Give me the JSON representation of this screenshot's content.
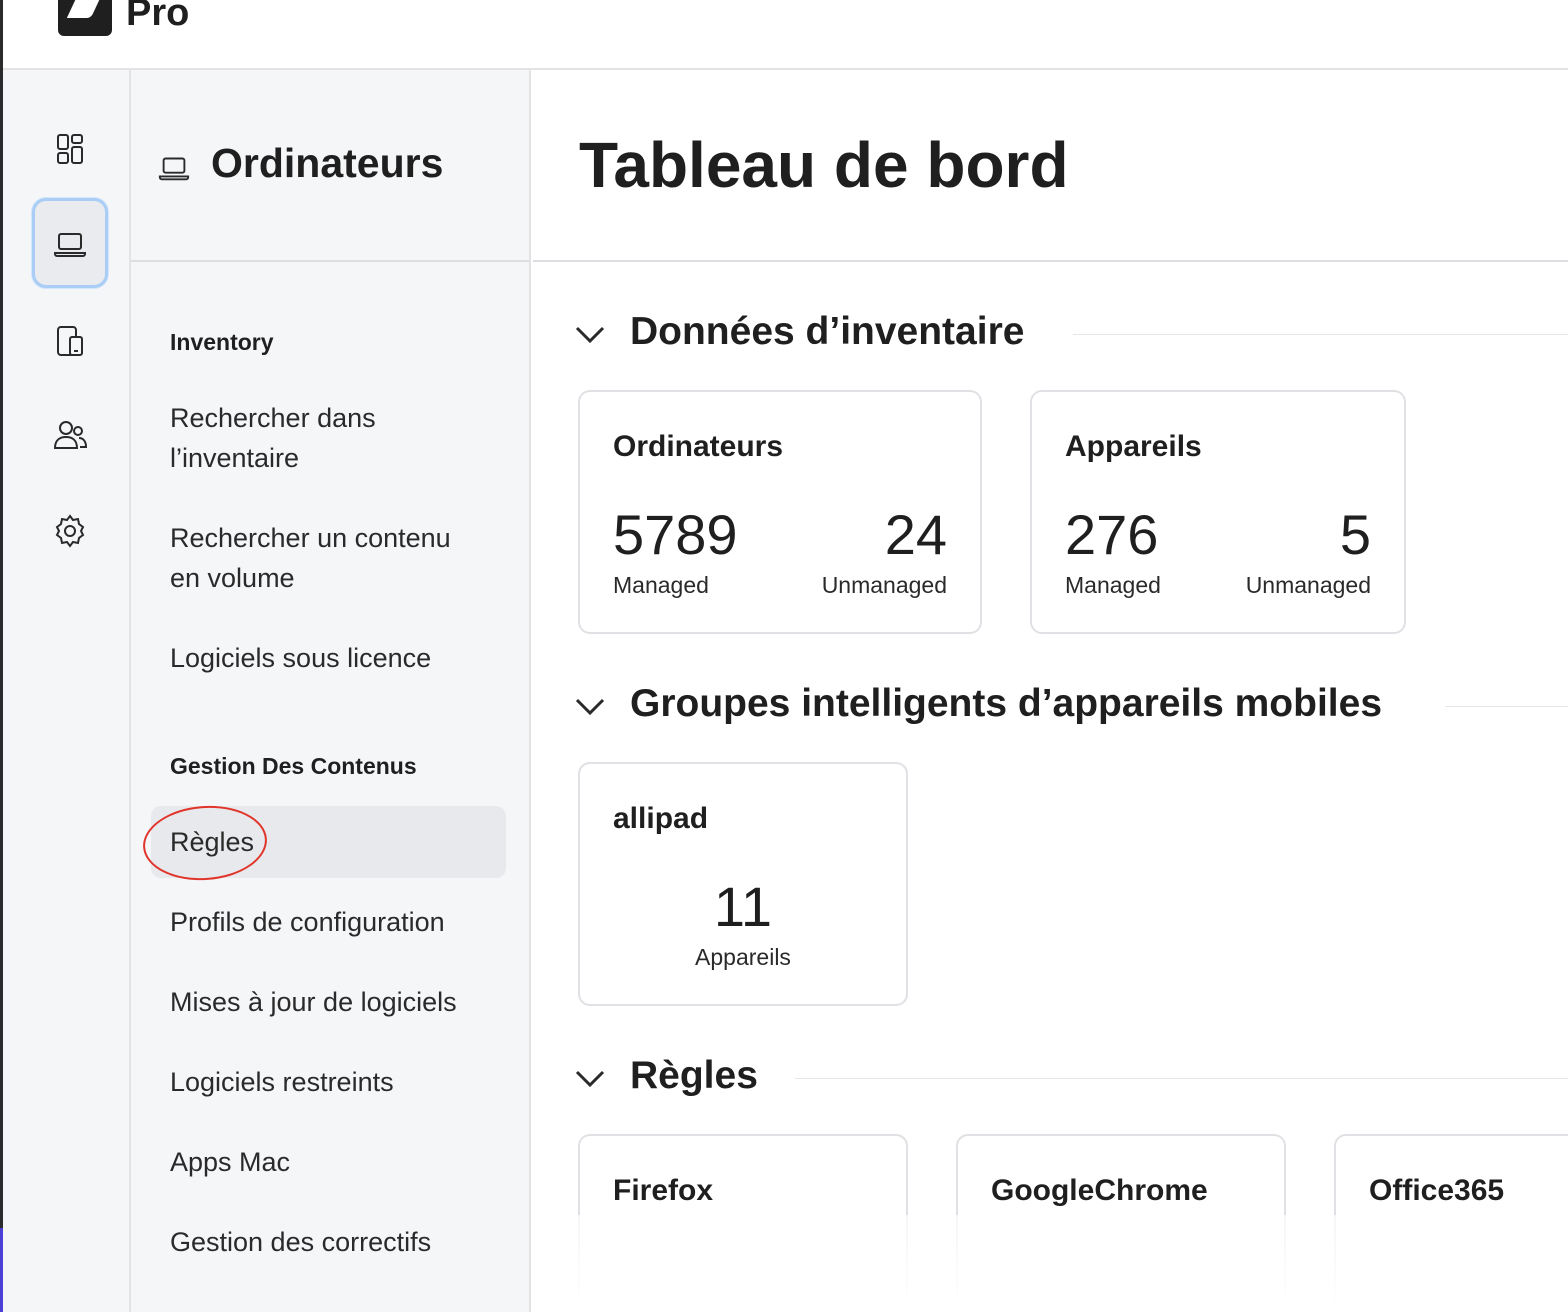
{
  "app": {
    "name": "Pro"
  },
  "rail": {
    "items": [
      {
        "icon": "dashboard-icon"
      },
      {
        "icon": "laptop-icon",
        "active": true
      },
      {
        "icon": "devices-icon"
      },
      {
        "icon": "users-icon"
      },
      {
        "icon": "gear-icon"
      }
    ]
  },
  "sidebar": {
    "title": "Ordinateurs",
    "icon": "laptop-icon",
    "sections": [
      {
        "label": "Inventory",
        "items": [
          {
            "label_line1": "Rechercher dans",
            "label_line2": "l’inventaire"
          },
          {
            "label_line1": "Rechercher un contenu",
            "label_line2": "en volume"
          },
          {
            "label_line1": "Logiciels sous licence"
          }
        ]
      },
      {
        "label": "Gestion Des Contenus",
        "items": [
          {
            "label_line1": "Règles",
            "selected": true
          },
          {
            "label_line1": "Profils de configuration"
          },
          {
            "label_line1": "Mises à jour de logiciels"
          },
          {
            "label_line1": "Logiciels restreints"
          },
          {
            "label_line1": "Apps Mac"
          },
          {
            "label_line1": "Gestion des correctifs"
          }
        ]
      }
    ]
  },
  "main": {
    "title": "Tableau de bord",
    "sections": [
      {
        "title": "Données d’inventaire",
        "cards": [
          {
            "title": "Ordinateurs",
            "managed": "5789",
            "managed_label": "Managed",
            "unmanaged": "24",
            "unmanaged_label": "Unmanaged"
          },
          {
            "title": "Appareils",
            "managed": "276",
            "managed_label": "Managed",
            "unmanaged": "5",
            "unmanaged_label": "Unmanaged"
          }
        ]
      },
      {
        "title": "Groupes intelligents d’appareils mobiles",
        "cards": [
          {
            "title": "allipad",
            "count": "11",
            "count_label": "Appareils"
          }
        ]
      },
      {
        "title": "Règles",
        "cards": [
          {
            "title": "Firefox"
          },
          {
            "title": "GoogleChrome"
          },
          {
            "title": "Office365"
          }
        ]
      }
    ]
  },
  "colors": {
    "active_ring": "#a9cdf5",
    "annotation": "#e0352b",
    "sidebar_bg": "#f5f6f8"
  }
}
